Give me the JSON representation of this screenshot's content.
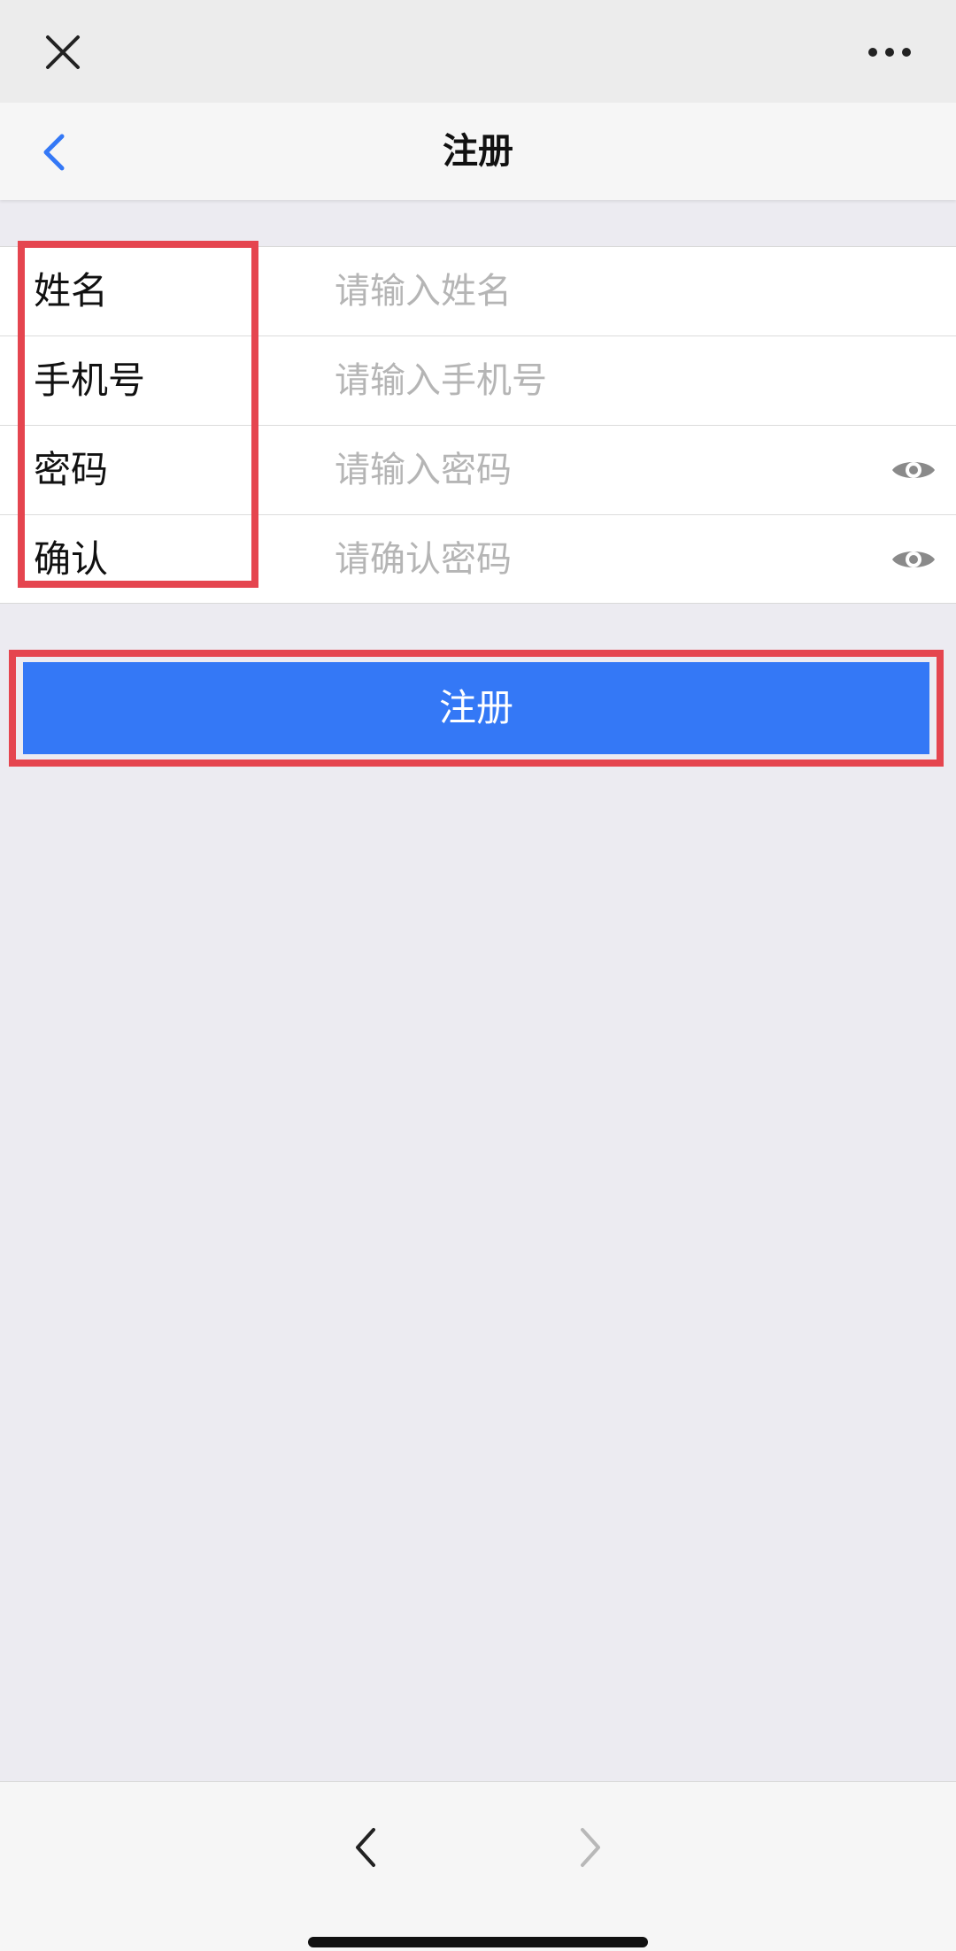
{
  "header": {
    "title": "注册",
    "close_icon": "close-icon",
    "more_icon": "more-icon",
    "back_icon": "chevron-left-icon"
  },
  "form": {
    "rows": [
      {
        "label": "姓名",
        "placeholder": "请输入姓名",
        "has_eye": false
      },
      {
        "label": "手机号",
        "placeholder": "请输入手机号",
        "has_eye": false
      },
      {
        "label": "密码",
        "placeholder": "请输入密码",
        "has_eye": true
      },
      {
        "label": "确认",
        "placeholder": "请确认密码",
        "has_eye": true
      }
    ]
  },
  "submit": {
    "label": "注册"
  },
  "colors": {
    "accent": "#3478f6",
    "highlight": "#e5454f",
    "back_chevron": "#3478f6"
  },
  "bottom_nav": {
    "back_icon": "chevron-left-icon",
    "forward_icon": "chevron-right-icon"
  }
}
